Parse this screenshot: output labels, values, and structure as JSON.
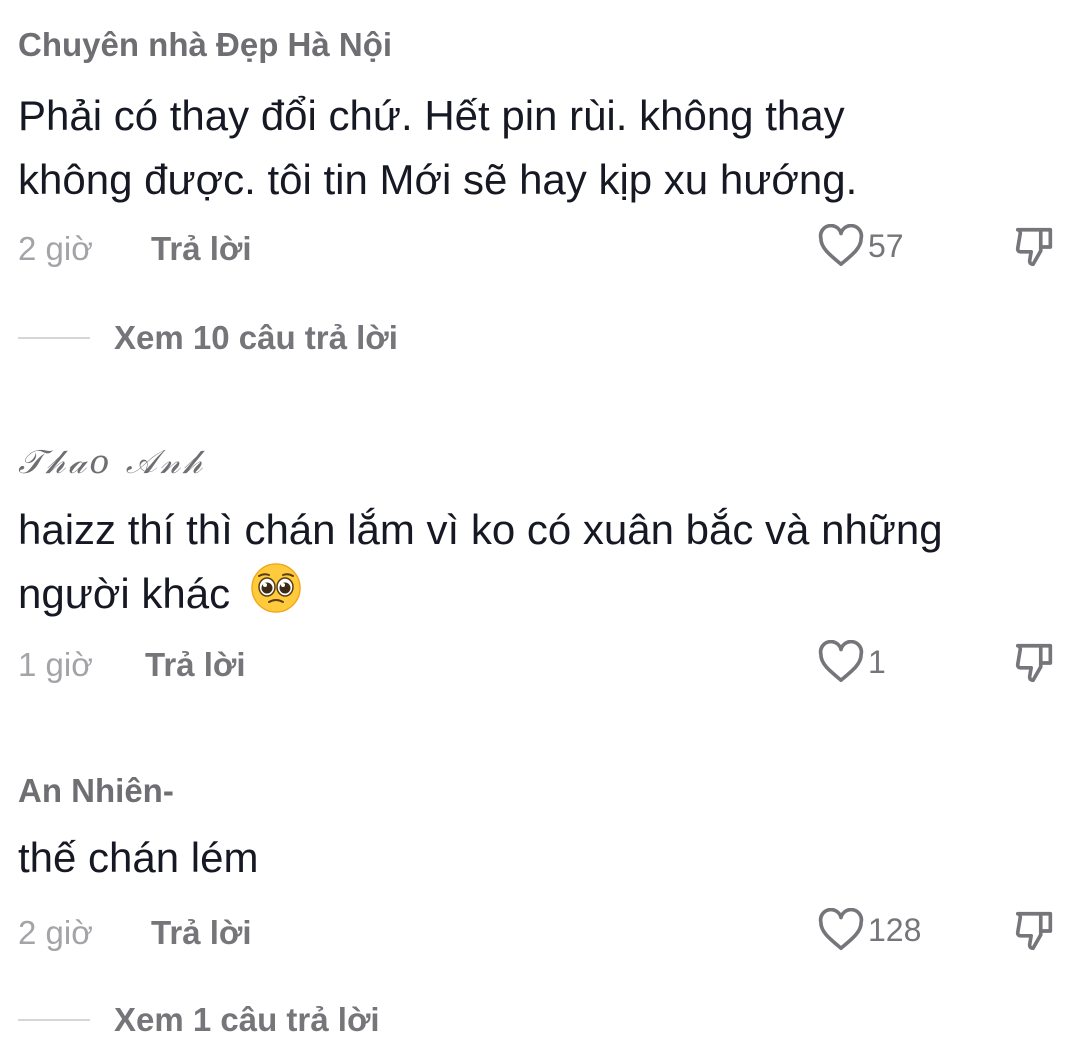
{
  "comments": [
    {
      "username": "Chuyên nhà Đẹp Hà Nội",
      "text_line1": "Phải có thay đổi chứ. Hết pin rùi. không thay",
      "text_line2": "không được. tôi tin Mới sẽ hay kịp xu hướng.",
      "time": "2 giờ",
      "reply_label": "Trả lời",
      "likes": "57",
      "view_replies": "Xem 10 câu trả lời"
    },
    {
      "username": "𝒯𝒽𝒶𝑜 𝒜𝓃𝒽",
      "text_line1": "haizz thí thì chán lắm vì ko có xuân bắc và những",
      "text_line2": "người khác",
      "emoji": "pleading-face",
      "time": "1 giờ",
      "reply_label": "Trả lời",
      "likes": "1"
    },
    {
      "username": "An Nhiên-",
      "text_line1": "thế chán lém",
      "time": "2 giờ",
      "reply_label": "Trả lời",
      "likes": "128",
      "view_replies": "Xem 1 câu trả lời"
    }
  ],
  "colors": {
    "text": "#161823",
    "secondary": "#75757a",
    "muted": "#a3a3a8",
    "divider": "#d6d6d9"
  },
  "icons": {
    "like": "heart-outline-icon",
    "dislike": "thumbs-down-icon"
  }
}
